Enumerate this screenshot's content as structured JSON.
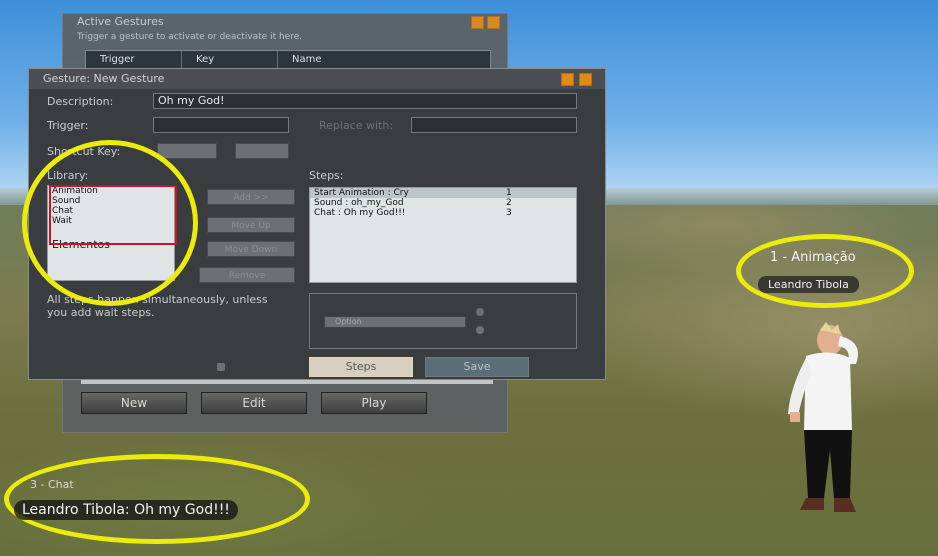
{
  "background_window": {
    "title": "Active Gestures",
    "subtitle": "Trigger a gesture to activate or deactivate it here.",
    "columns": [
      "Trigger",
      "Key",
      "Name"
    ],
    "buttons": [
      "New",
      "Edit",
      "Play"
    ]
  },
  "gesture_window": {
    "title": "Gesture: New Gesture",
    "description_label": "Description:",
    "description_value": "Oh my God!",
    "trigger_label": "Trigger:",
    "replace_label": "Replace with:",
    "shortcut_label": "Shortcut Key:",
    "library_label": "Library:",
    "library_items": [
      "Animation",
      "Sound",
      "Chat",
      "Wait"
    ],
    "library_buttons": [
      "Add >>",
      "Move Up",
      "Move Down",
      "Remove"
    ],
    "steps_label": "Steps:",
    "steps": [
      {
        "name": "Start Animation : Cry",
        "num": "1"
      },
      {
        "name": "Sound : oh_my_God",
        "num": "2"
      },
      {
        "name": "Chat : Oh my God!!!",
        "num": "3"
      }
    ],
    "note": "All steps happen simultaneously, unless you add wait steps.",
    "option_label": "Option",
    "tabs": [
      "Steps",
      "Save"
    ]
  },
  "annotations": {
    "elements_label": "Elementos",
    "animacao_label": "1 - Animação",
    "avatar_name": "Leandro Tibola",
    "chat_label": "3 - Chat",
    "chat_message": "Leandro Tibola: Oh my God!!!"
  },
  "colors": {
    "highlight_ellipse": "#ecec0c",
    "red_box": "#c9151f",
    "window_bg": "#3a3d40"
  }
}
